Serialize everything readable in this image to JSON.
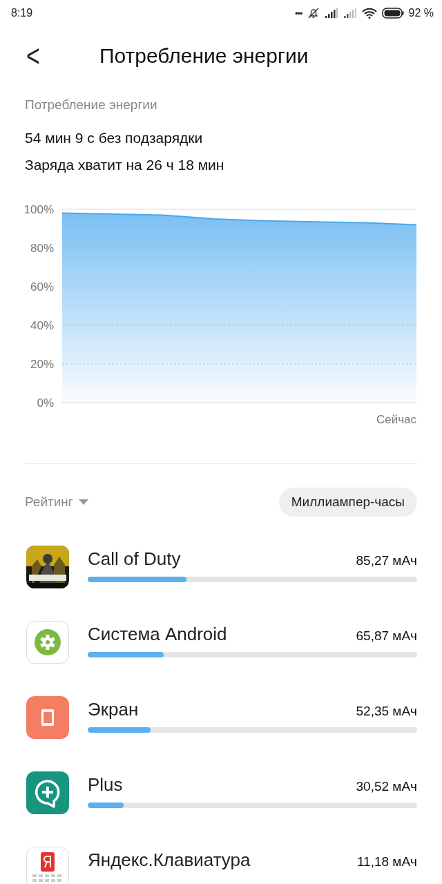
{
  "status_bar": {
    "time": "8:19",
    "notification_dots": "•••",
    "battery_percent": "92 %"
  },
  "header": {
    "back": "<",
    "title": "Потребление энергии"
  },
  "summary": {
    "caption": "Потребление энергии",
    "lines": [
      "54 мин 9 с без подзарядки",
      "Заряда хватит на 26 ч 18 мин"
    ]
  },
  "chart_data": {
    "type": "area",
    "categories": [
      null,
      null,
      null,
      null,
      null,
      null,
      null,
      "Сейчас"
    ],
    "series": [
      {
        "color": "#4aa8ee",
        "values": [
          98,
          97.5,
          97,
          95,
          94,
          93.5,
          93,
          92
        ]
      }
    ],
    "ylim": [
      0,
      100
    ],
    "grid": true,
    "yticks": [
      {
        "value": 0,
        "label": "0%"
      },
      {
        "value": 20,
        "label": "20%"
      },
      {
        "value": 40,
        "label": "40%"
      },
      {
        "value": 60,
        "label": "60%"
      },
      {
        "value": 80,
        "label": "80%"
      },
      {
        "value": 100,
        "label": "100%"
      }
    ]
  },
  "sort": {
    "label": "Рейтинг",
    "unit_button": "Миллиампер-часы"
  },
  "apps": [
    {
      "kind": "picture",
      "name": "Call of Duty",
      "usage": "85,27 мАч",
      "level": 0.3
    },
    {
      "kind": "gear",
      "name": "Система Android",
      "usage": "65,87 мАч",
      "level": 0.23
    },
    {
      "kind": "screen",
      "name": "Экран",
      "usage": "52,35 мАч",
      "level": 0.19
    },
    {
      "kind": "plus",
      "name": "Plus",
      "usage": "30,52 мАч",
      "level": 0.11
    },
    {
      "kind": "keyboard",
      "name": "Яндекс.Клавиатура",
      "usage": "11,18 мАч"
    }
  ]
}
